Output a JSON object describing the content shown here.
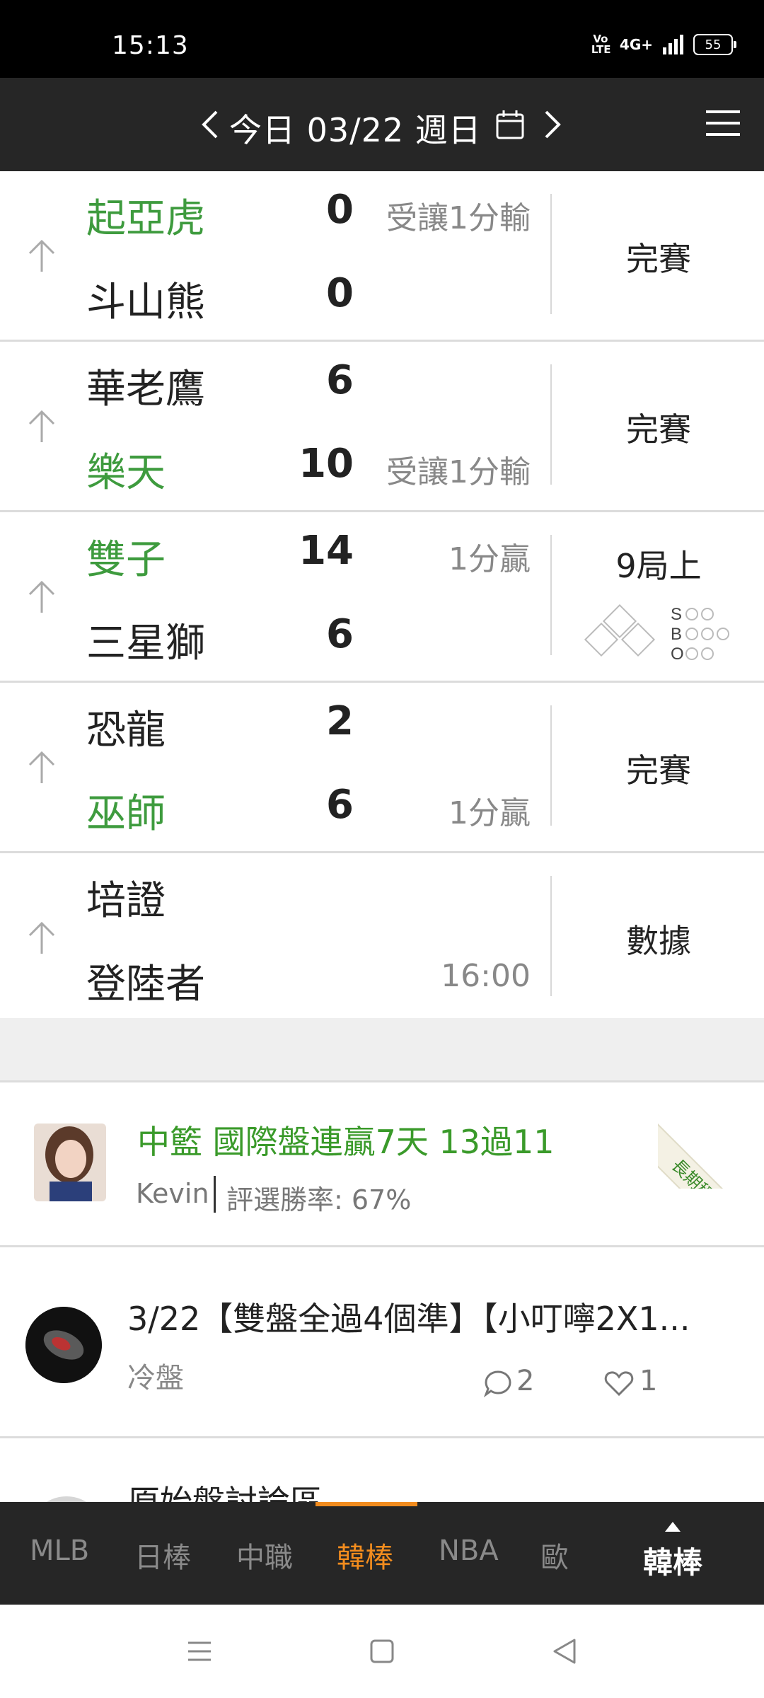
{
  "status_bar": {
    "time": "15:13",
    "volte": "Vo LTE",
    "network": "4G+",
    "battery": "55"
  },
  "header": {
    "title": "今日 03/22 週日"
  },
  "games": [
    {
      "team1": "起亞虎",
      "team1_color": "green",
      "score1": "0",
      "note1": "受讓1分輸",
      "team2": "斗山熊",
      "team2_color": "dark",
      "score2": "0",
      "note2": "",
      "status": "完賽"
    },
    {
      "team1": "華老鷹",
      "team1_color": "dark",
      "score1": "6",
      "note1": "",
      "team2": "樂天",
      "team2_color": "green",
      "score2": "10",
      "note2": "受讓1分輸",
      "status": "完賽"
    },
    {
      "team1": "雙子",
      "team1_color": "green",
      "score1": "14",
      "note1": "1分贏",
      "team2": "三星獅",
      "team2_color": "dark",
      "score2": "6",
      "note2": "",
      "status": "9局上",
      "live": true,
      "sbo": [
        "S",
        "B",
        "O"
      ]
    },
    {
      "team1": "恐龍",
      "team1_color": "dark",
      "score1": "2",
      "note1": "",
      "team2": "巫師",
      "team2_color": "green",
      "score2": "6",
      "note2": "1分贏",
      "status": "完賽"
    },
    {
      "team1": "培證",
      "team1_color": "dark",
      "score1": "",
      "note1": "",
      "team2": "登陸者",
      "team2_color": "dark",
      "score2": "",
      "note2": "16:00",
      "status": "數據"
    }
  ],
  "posts": [
    {
      "title": "中籃 國際盤連贏7天 13過11",
      "author": "Kevin",
      "rate": "評選勝率: 67%",
      "ribbon": "長期穩定"
    },
    {
      "title": "3/22【雙盤全過4個準】【小叮嚀2X1...",
      "subtitle": "冷盤",
      "comments": "2",
      "likes": "1"
    },
    {
      "title": "原始盤討論區"
    }
  ],
  "tabs": {
    "t1": "MLB",
    "t2": "日棒",
    "t3": "中職",
    "t4": "韓棒",
    "t5": "NBA",
    "t6": "歐",
    "current": "韓棒"
  },
  "colors": {
    "green": "#3e9b3e",
    "accent": "#f28c1e",
    "header_bg": "#262626"
  }
}
